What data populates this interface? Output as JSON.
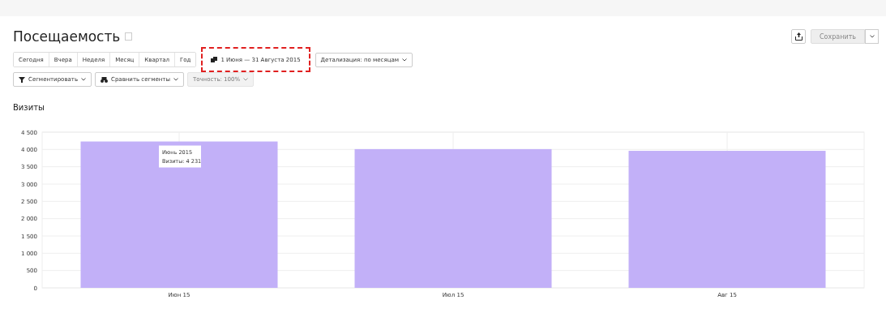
{
  "title": "Посещаемость",
  "periods": [
    {
      "label": "Сегодня",
      "selected": false
    },
    {
      "label": "Вчера",
      "selected": false
    },
    {
      "label": "Неделя",
      "selected": false
    },
    {
      "label": "Месяц",
      "selected": false
    },
    {
      "label": "Квартал",
      "selected": false
    },
    {
      "label": "Год",
      "selected": false
    }
  ],
  "date_range": "1 Июня — 31 Августа 2015",
  "detail_dropdown": "Детализация: по месяцам",
  "segment_buttons": [
    {
      "label": "Сегментировать",
      "disabled": false
    },
    {
      "label": "Сравнить сегменты",
      "disabled": false
    },
    {
      "label": "Точность: 100%",
      "disabled": true
    }
  ],
  "save_button": {
    "label": "Сохранить",
    "disabled": true
  },
  "chart": {
    "title": "Визиты",
    "tooltip": [
      "Июнь 2015",
      "Визиты: 4 231"
    ],
    "chart_data": {
      "type": "bar",
      "categories": [
        "Июн 15",
        "Июл 15",
        "Авг 15"
      ],
      "series": [
        {
          "color": "#c2b0f8",
          "values": [
            4230,
            4010,
            3960
          ]
        }
      ],
      "grid": true,
      "ylim": [
        0,
        4500
      ],
      "yticks": [
        {
          "value": 0,
          "label": "0"
        },
        {
          "value": 500,
          "label": "500"
        },
        {
          "value": 1000,
          "label": "1 000"
        },
        {
          "value": 1500,
          "label": "1 500"
        },
        {
          "value": 2000,
          "label": "2 000"
        },
        {
          "value": 2500,
          "label": "2 500"
        },
        {
          "value": 3000,
          "label": "3 000"
        },
        {
          "value": 3500,
          "label": "3 500"
        },
        {
          "value": 4000,
          "label": "4 000"
        },
        {
          "value": 4500,
          "label": "4 500"
        }
      ]
    }
  }
}
